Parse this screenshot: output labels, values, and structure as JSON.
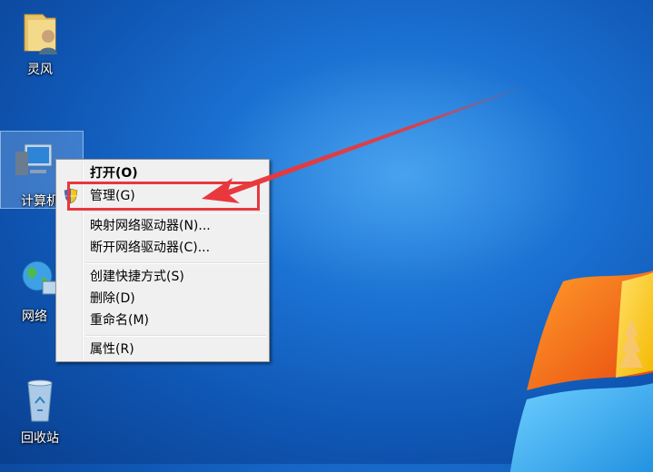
{
  "desktop": {
    "icons": [
      {
        "label": "灵风"
      },
      {
        "label": "计算机"
      },
      {
        "label": "网络"
      },
      {
        "label": "回收站"
      }
    ]
  },
  "context_menu": {
    "items": [
      {
        "label": "打开(O)",
        "bold": true
      },
      {
        "label": "管理(G)",
        "highlighted": true
      },
      {
        "label": "映射网络驱动器(N)..."
      },
      {
        "label": "断开网络驱动器(C)..."
      },
      {
        "label": "创建快捷方式(S)"
      },
      {
        "label": "删除(D)"
      },
      {
        "label": "重命名(M)"
      },
      {
        "label": "属性(R)"
      }
    ]
  },
  "annotation": {
    "color": "#e8383d"
  },
  "colors": {
    "desktop": "#1a6fd0",
    "menu_bg": "#f0f0f0"
  }
}
